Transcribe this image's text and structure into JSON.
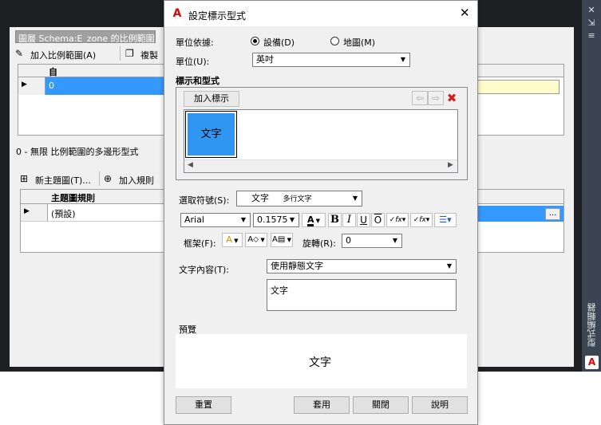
{
  "background_panel": {
    "layer_label": "圖層 Schema:E_zone 的比例範圍",
    "add_scale_range": "加入比例範圍(A)",
    "copy_label": "複製",
    "grid1_header": "自",
    "grid1_row_value": "0",
    "range_caption": "0 - 無限 比例範圍的多邊形型式",
    "new_theme": "新主題圖(T)...",
    "add_rule": "加入規則",
    "grid2_header": "主題圖規則",
    "grid2_row": "(預設)",
    "ellipsis": "..."
  },
  "right_bar": {
    "title": "型式編輯器",
    "logo": "A",
    "close_glyph": "✕",
    "pin_glyph": "⇲",
    "menu_glyph": "≡"
  },
  "dialog": {
    "logo": "A",
    "title": "設定標示型式",
    "close_glyph": "✕",
    "unit_basis_label": "單位依據:",
    "radio_device": "設備(D)",
    "radio_map": "地圖(M)",
    "unit_label": "單位(U):",
    "unit_value": "英吋",
    "labels_styles_header": "標示和型式",
    "add_label_button": "加入標示",
    "label_tile_text": "文字",
    "select_symbol_label": "選取符號(S):",
    "symbol_value": "文字",
    "symbol_value_sub": "多行文字",
    "font_value": "Arial",
    "size_value": "0.1575",
    "bold": "B",
    "italic": "I",
    "underline": "U",
    "overline": "O",
    "frame_label": "框架(F):",
    "rotation_label": "旋轉(R):",
    "rotation_value": "0",
    "text_content_label": "文字內容(T):",
    "text_content_mode": "使用靜態文字",
    "text_content_value": "文字",
    "preview_label": "預覽",
    "preview_text": "文字",
    "reset_button": "重置",
    "apply_button": "套用",
    "close_button": "關閉",
    "help_button": "說明"
  }
}
